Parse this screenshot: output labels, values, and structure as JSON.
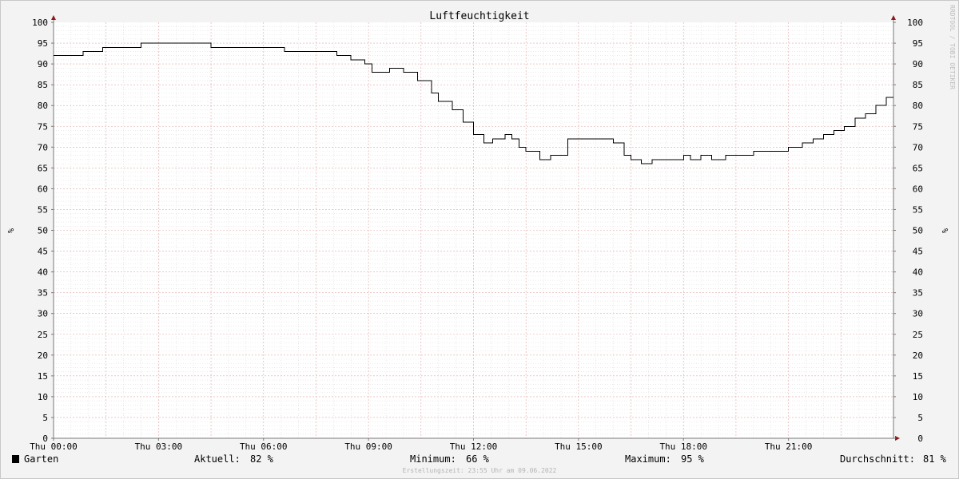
{
  "chart_data": {
    "type": "line",
    "title": "Luftfeuchtigkeit",
    "ylabel": "%",
    "ylabel_right": "%",
    "watermark": "RRDTOOL / TOBI OETIKER",
    "ylim": [
      0,
      100
    ],
    "xlim": [
      "Thu 00:00",
      "Thu 24:00"
    ],
    "grid": true,
    "y_ticks": [
      "0",
      "5",
      "10",
      "15",
      "20",
      "25",
      "30",
      "35",
      "40",
      "45",
      "50",
      "55",
      "60",
      "65",
      "70",
      "75",
      "80",
      "85",
      "90",
      "95",
      "100"
    ],
    "x_ticks": [
      {
        "label": "Thu 00:00",
        "hour": 0
      },
      {
        "label": "Thu 03:00",
        "hour": 3
      },
      {
        "label": "Thu 06:00",
        "hour": 6
      },
      {
        "label": "Thu 09:00",
        "hour": 9
      },
      {
        "label": "Thu 12:00",
        "hour": 12
      },
      {
        "label": "Thu 15:00",
        "hour": 15
      },
      {
        "label": "Thu 18:00",
        "hour": 18
      },
      {
        "label": "Thu 21:00",
        "hour": 21
      }
    ],
    "series": [
      {
        "name": "Garten",
        "color": "#000000",
        "x_hours": [
          0,
          0.85,
          1.4,
          2.5,
          4.5,
          6.6,
          8.1,
          8.5,
          8.9,
          9.1,
          9.3,
          9.6,
          10.0,
          10.4,
          10.8,
          11.0,
          11.4,
          11.7,
          12.0,
          12.3,
          12.55,
          12.9,
          13.1,
          13.3,
          13.5,
          13.9,
          14.2,
          14.5,
          14.7,
          16.0,
          16.3,
          16.5,
          16.8,
          17.1,
          17.5,
          18.0,
          18.2,
          18.5,
          18.8,
          19.2,
          19.5,
          20.0,
          20.5,
          21.0,
          21.4,
          21.7,
          22.0,
          22.3,
          22.6,
          22.9,
          23.2,
          23.5,
          23.8,
          24.0
        ],
        "y": [
          92,
          93,
          94,
          95,
          94,
          93,
          92,
          91,
          90,
          88,
          88,
          89,
          88,
          86,
          83,
          81,
          79,
          76,
          73,
          71,
          72,
          73,
          72,
          70,
          69,
          67,
          68,
          68,
          72,
          71,
          68,
          67,
          66,
          67,
          67,
          68,
          67,
          68,
          67,
          68,
          68,
          69,
          69,
          70,
          71,
          72,
          73,
          74,
          75,
          77,
          78,
          80,
          82,
          82
        ]
      }
    ],
    "legend": {
      "placement": "bottom-left",
      "series_name": "Garten",
      "current_label": "Aktuell:",
      "current_value": "82 %",
      "min_label": "Minimum:",
      "min_value": "66 %",
      "max_label": "Maximum:",
      "max_value": "95 %",
      "avg_label": "Durchschnitt:",
      "avg_value": "81 %"
    },
    "footer": "Erstellungszeit: 23:55 Uhr am 09.06.2022"
  }
}
